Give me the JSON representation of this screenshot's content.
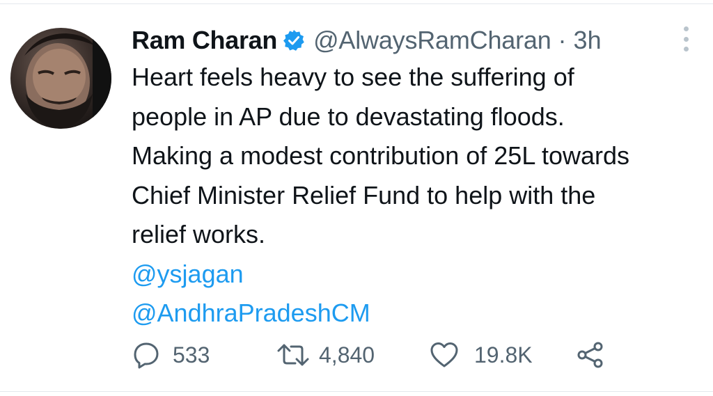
{
  "user": {
    "name": "Ram Charan",
    "handle": "@AlwaysRamCharan",
    "separator": "·",
    "time": "3h"
  },
  "tweet": {
    "lines": [
      "Heart feels heavy to see the suffering of",
      "people in AP due to devastating floods.",
      "Making a modest contribution of 25L towards",
      "Chief Minister Relief Fund to help with the",
      "relief works."
    ],
    "mentions": [
      "@ysjagan",
      "@AndhraPradeshCM"
    ]
  },
  "actions": {
    "replies": "533",
    "retweets": "4,840",
    "likes": "19.8K"
  },
  "icons": {
    "verified": "verified-badge-icon",
    "more": "more-options-icon",
    "reply": "reply-icon",
    "retweet": "retweet-icon",
    "like": "heart-icon",
    "share": "share-icon"
  },
  "colors": {
    "link": "#1d9bf0",
    "muted": "#536471",
    "text": "#0f1419"
  }
}
